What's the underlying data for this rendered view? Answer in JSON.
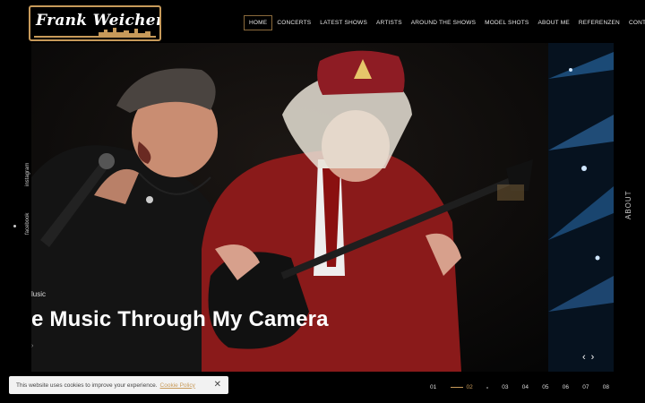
{
  "logo": {
    "text": "Frank Weichert"
  },
  "nav": {
    "items": [
      {
        "label": "HOME",
        "active": true
      },
      {
        "label": "CONCERTS"
      },
      {
        "label": "LATEST SHOWS"
      },
      {
        "label": "ARTISTS"
      },
      {
        "label": "AROUND THE SHOWS"
      },
      {
        "label": "MODEL SHOTS"
      },
      {
        "label": "ABOUT ME"
      },
      {
        "label": "REFERENZEN"
      },
      {
        "label": "CONTACT"
      }
    ]
  },
  "hero": {
    "tag": "lusic",
    "title": "e Music Through My Camera",
    "arrow": "›"
  },
  "social": {
    "instagram": "instagram",
    "facebook": "facebook"
  },
  "about_label": "ABOUT",
  "slider": {
    "prev": "‹",
    "next": "›"
  },
  "pager": {
    "pages": [
      "01",
      "02",
      "03",
      "04",
      "05",
      "06",
      "07",
      "08"
    ],
    "active_index": 1
  },
  "cookie": {
    "text": "This website uses cookies to improve your experience.",
    "link": "Cookie Policy",
    "close": "✕"
  },
  "colors": {
    "accent": "#c79a5a",
    "background": "#000000",
    "cookie_bg": "#f2f2f2"
  }
}
